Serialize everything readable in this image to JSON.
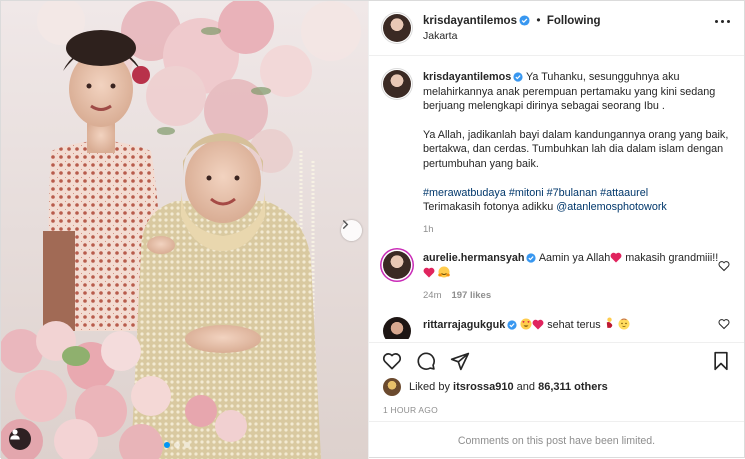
{
  "post": {
    "author": "krisdayantilemos",
    "follow_status": "Following",
    "location": "Jakarta",
    "carousel": {
      "slide_count": 3,
      "active_slide": 1
    }
  },
  "caption": {
    "username": "krisdayantilemos",
    "para1": "Ya Tuhanku, sesungguhnya aku melahirkannya anak perempuan pertamaku yang kini sedang berjuang melengkapi dirinya sebagai seorang Ibu .",
    "para2": "Ya Allah, jadikanlah bayi dalam kandungannya orang yang baik, bertakwa, dan cerdas. Tumbuhkan lah dia dalam islam dengan pertumbuhan yang baik.",
    "hashtags": [
      "#merawatbudaya",
      "#mitoni",
      "#7bulanan",
      "#attaaurel"
    ],
    "thanks_prefix": "Terimakasih fotonya adikku ",
    "thanks_mention": "@atanlemosphotowork",
    "time": "1h"
  },
  "comments": [
    {
      "username": "aurelie.hermansyah",
      "text_a": "Aamin ya Allah",
      "text_b": " makasih grandmiii!!",
      "time": "24m",
      "likes": "197 likes"
    },
    {
      "username": "rittarrajagukguk",
      "text": " sehat terus "
    }
  ],
  "likes": {
    "prefix": "Liked by ",
    "user": "itsrossa910",
    "middle": " and ",
    "count": "86,311 others"
  },
  "timestamp": "1 HOUR AGO",
  "comments_status": "Comments on this post have been limited.",
  "colors": {
    "link": "#00376b",
    "active_dot": "#0095f6",
    "verified": "#3897f0",
    "heart": "#ed4956",
    "muted": "#8e8e8e"
  }
}
